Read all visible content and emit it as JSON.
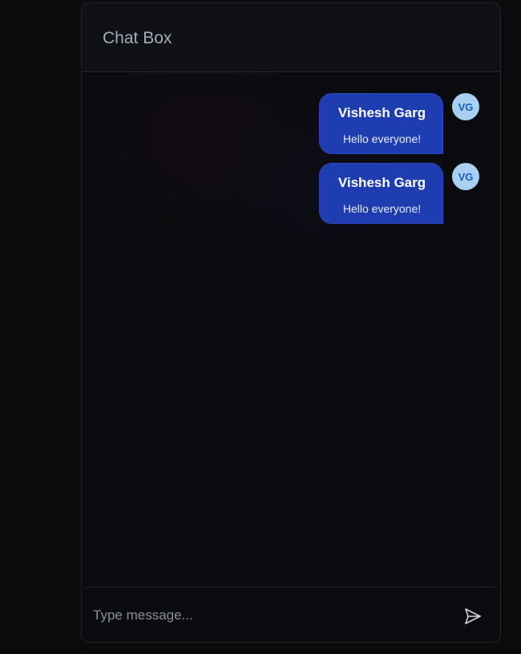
{
  "header": {
    "title": "Chat Box"
  },
  "messages": [
    {
      "sender": "Vishesh Garg",
      "text": "Hello everyone!",
      "avatar_initials": "VG"
    },
    {
      "sender": "Vishesh Garg",
      "text": "Hello everyone!",
      "avatar_initials": "VG"
    }
  ],
  "composer": {
    "placeholder": "Type message...",
    "value": "",
    "send_icon": "send-icon"
  },
  "colors": {
    "bubble": "#1e3db0",
    "avatar_bg": "#a9cff3",
    "avatar_text": "#1d5fb8",
    "page_bg": "#0a0b0d"
  }
}
